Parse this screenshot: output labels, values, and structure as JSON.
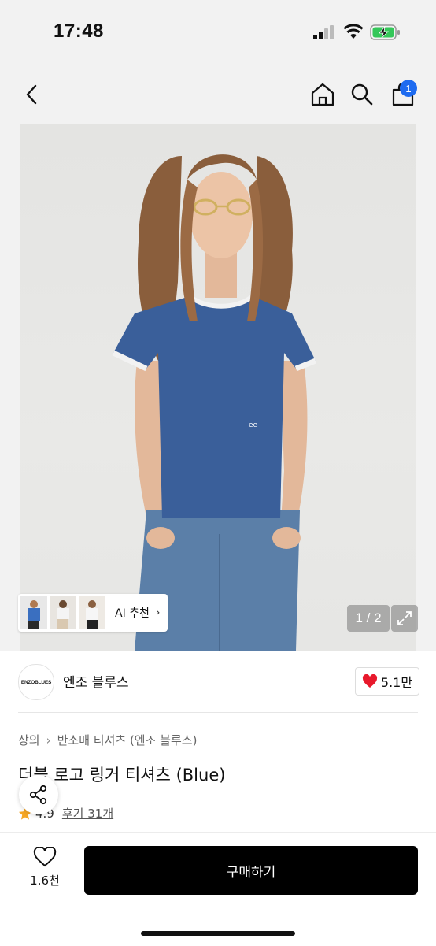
{
  "status_bar": {
    "time": "17:48"
  },
  "header": {
    "cart_count": "1"
  },
  "gallery": {
    "ai_label": "AI 추천",
    "counter": "1 / 2"
  },
  "brand": {
    "logo_text": "ENZOBLUES",
    "name": "엔조 블루스",
    "likes": "5.1만"
  },
  "breadcrumb": {
    "category": "상의",
    "subcategory": "반소매 티셔츠 (엔조 블루스)"
  },
  "product": {
    "title": "더블 로고 링거 티셔츠 (Blue)",
    "rating": "4.9",
    "reviews": "후기 31개"
  },
  "bottom_bar": {
    "wish_count": "1.6천",
    "buy_label": "구매하기"
  },
  "colors": {
    "accent": "#1e6bf0",
    "heart": "#e8192c",
    "star": "#f5a623",
    "buy_bg": "#000000"
  }
}
